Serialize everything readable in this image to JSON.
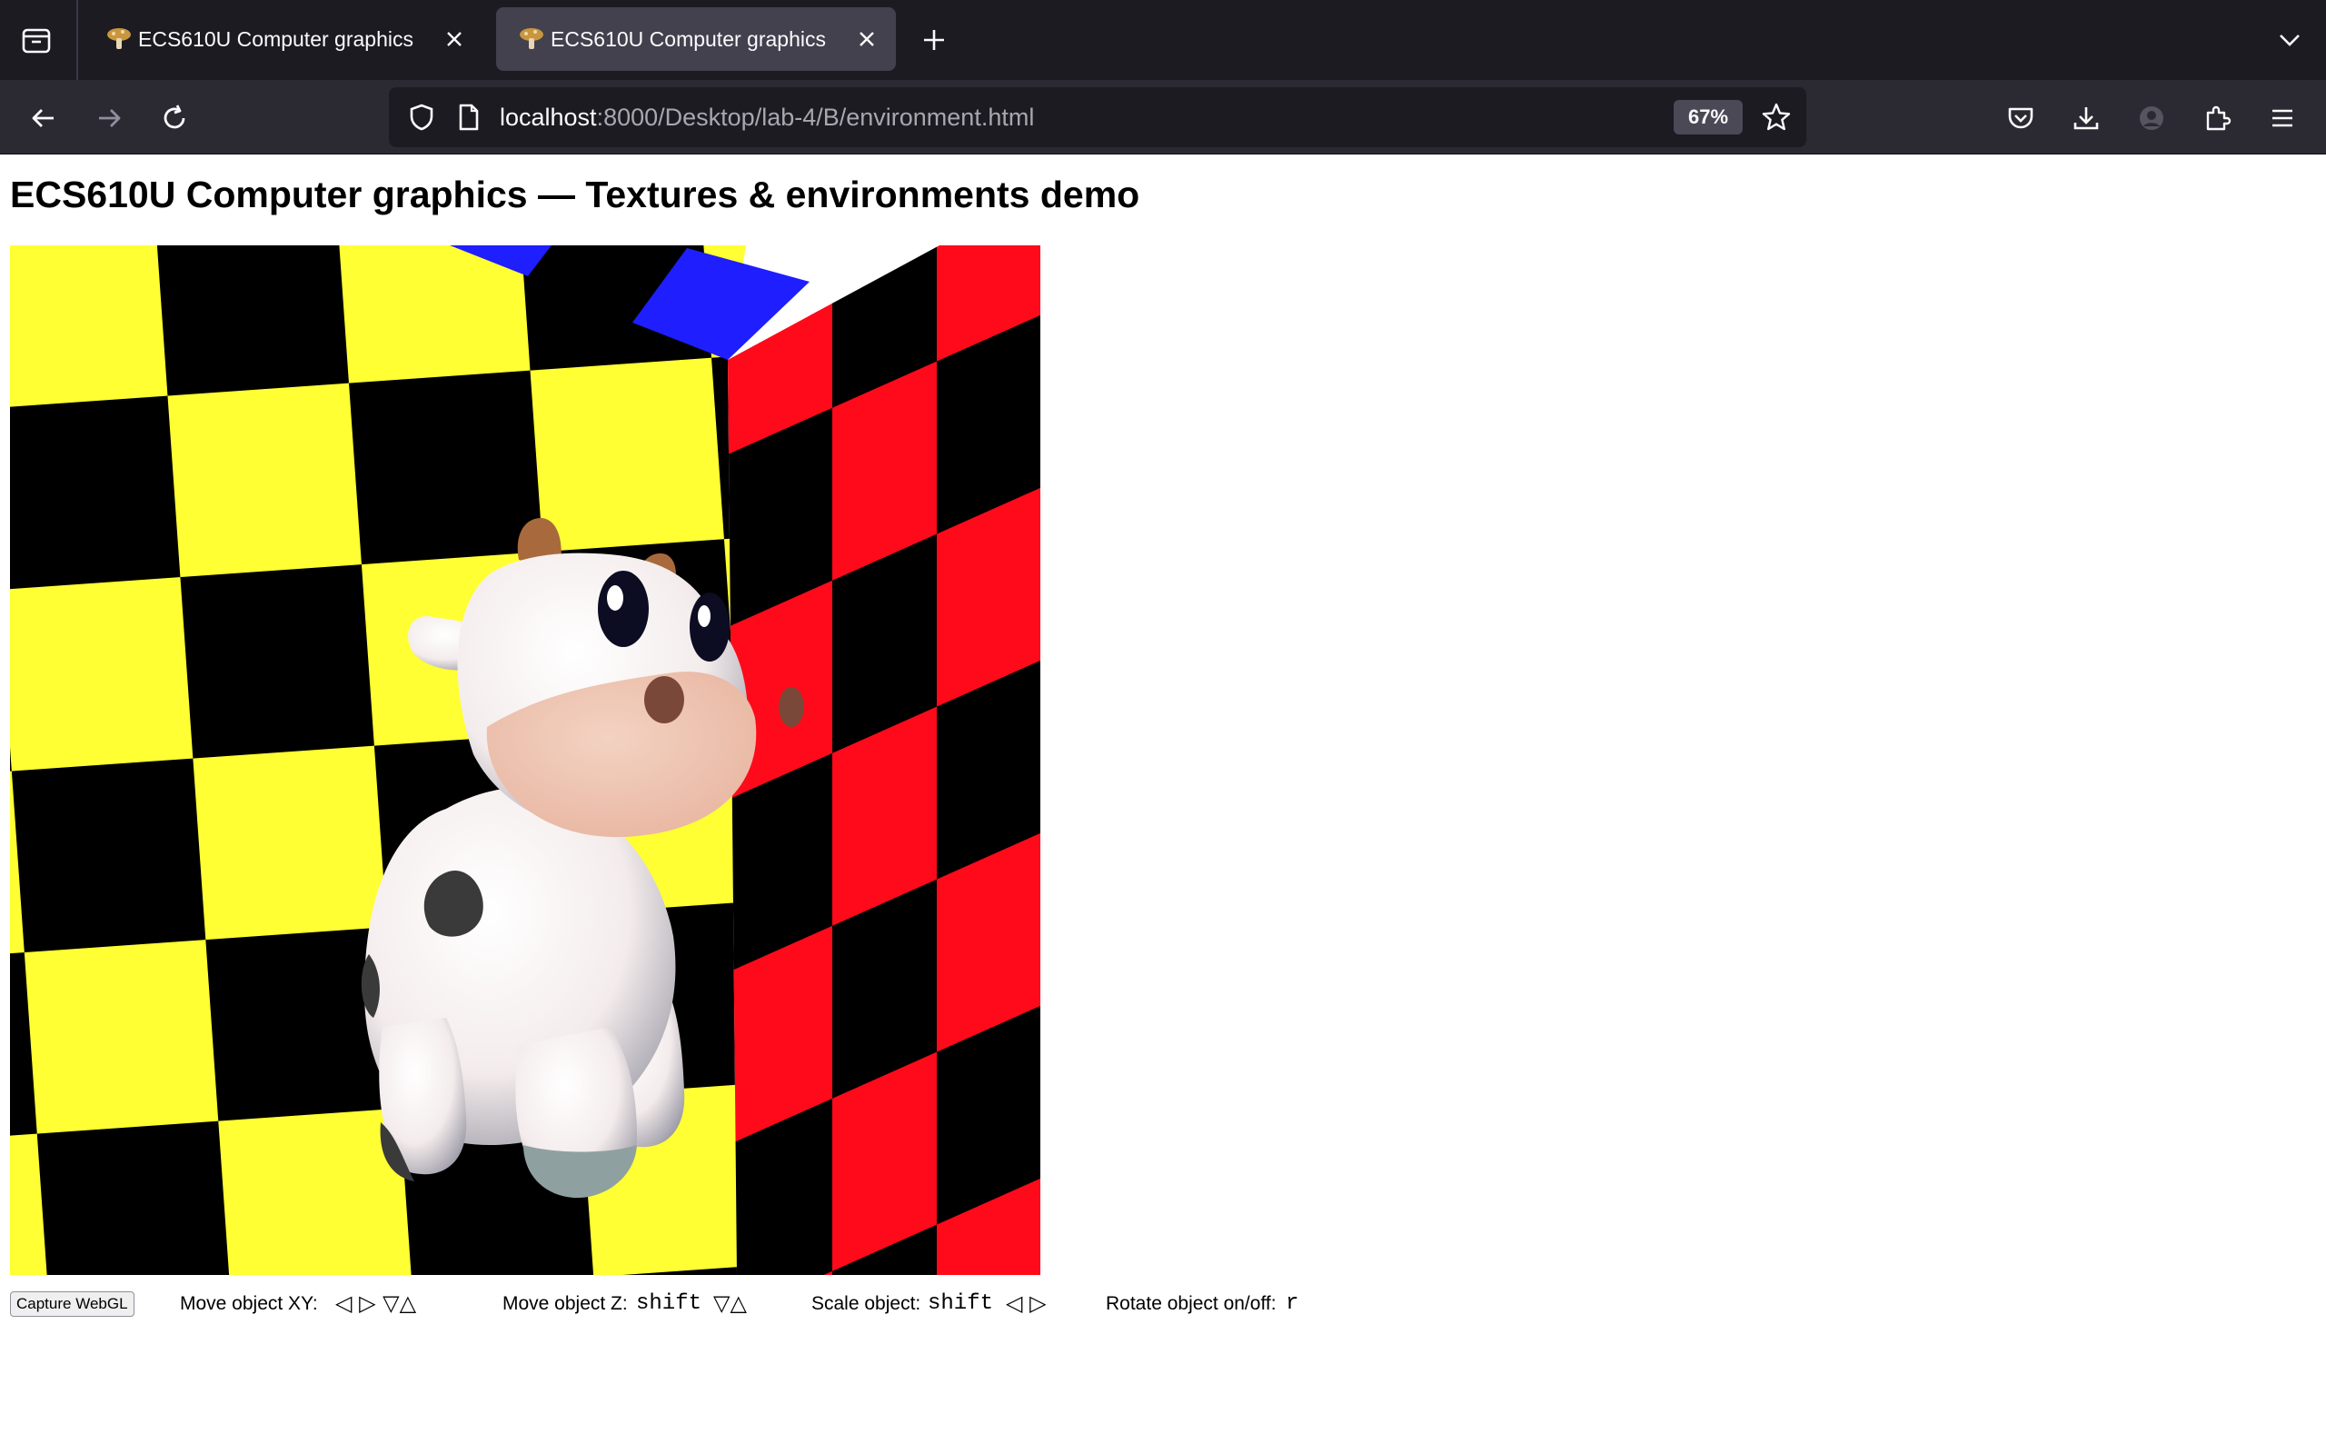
{
  "browser": {
    "tabs": [
      {
        "title": "ECS610U Computer graphics",
        "active": false
      },
      {
        "title": "ECS610U Computer graphics",
        "active": true
      }
    ],
    "url": {
      "host": "localhost",
      "rest": ":8000/Desktop/lab-4/B/environment.html"
    },
    "zoom": "67%"
  },
  "page": {
    "title": "ECS610U Computer graphics — Textures & environments demo"
  },
  "controls": {
    "capture_label": "Capture WebGL",
    "move_xy_label": "Move object XY:",
    "move_xy_keys": "◁ ▷ ▽△",
    "move_z_label": "Move object Z:",
    "move_z_mod": "shift",
    "move_z_keys": "▽△",
    "scale_label": "Scale object:",
    "scale_mod": "shift",
    "scale_keys": "◁ ▷",
    "rotate_label": "Rotate object on/off:",
    "rotate_key": "r"
  },
  "scene": {
    "colors": {
      "back_wall_check": "#ffff33",
      "side_wall_check": "#ff0a1a",
      "ceiling_check": "#1e1eff",
      "dark_check": "#000000",
      "cow_body": "#f4ecec",
      "cow_spots": "#3a3a3a",
      "cow_horns": "#a86a3c",
      "cow_muzzle": "#e8b5a0"
    }
  },
  "icons": {
    "tab_overview": "tab-overview-icon",
    "back": "back-arrow-icon",
    "forward": "forward-arrow-icon",
    "reload": "reload-icon",
    "shield": "tracking-protection-shield-icon",
    "page": "page-info-icon",
    "bookmark": "star-bookmark-icon",
    "pocket": "pocket-icon",
    "downloads": "download-icon",
    "account": "account-icon",
    "extensions": "extensions-puzzle-icon",
    "menu": "hamburger-menu-icon"
  }
}
